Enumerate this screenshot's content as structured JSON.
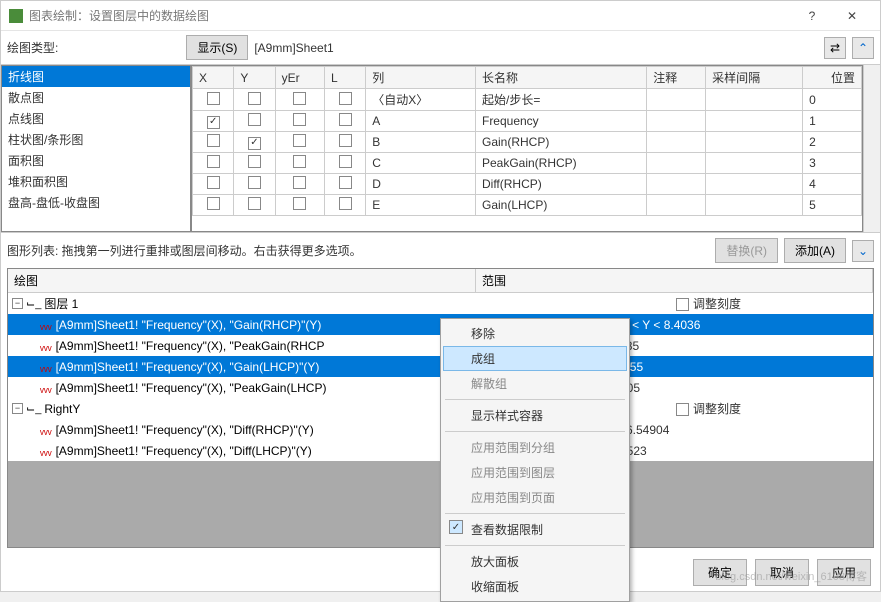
{
  "window": {
    "title": "图表绘制：设置图层中的数据绘图"
  },
  "topbar": {
    "plot_type_label": "绘图类型:",
    "show_button": "显示(S)",
    "sheet_name": "[A9mm]Sheet1"
  },
  "plot_types": [
    "折线图",
    "散点图",
    "点线图",
    "柱状图/条形图",
    "面积图",
    "堆积面积图",
    "盘高-盘低-收盘图"
  ],
  "plot_types_selected": 0,
  "grid": {
    "headers": [
      "X",
      "Y",
      "yEr",
      "L",
      "列",
      "长名称",
      "注释",
      "采样间隔",
      "位置"
    ],
    "rows": [
      {
        "x": false,
        "y": false,
        "yer": false,
        "l": false,
        "col": "〈自动X〉",
        "name": "起始/步长=",
        "pos": "0"
      },
      {
        "x": true,
        "y": false,
        "yer": false,
        "l": false,
        "col": "A",
        "name": "Frequency",
        "pos": "1"
      },
      {
        "x": false,
        "y": true,
        "yer": false,
        "l": false,
        "col": "B",
        "name": "Gain(RHCP)",
        "pos": "2"
      },
      {
        "x": false,
        "y": false,
        "yer": false,
        "l": false,
        "col": "C",
        "name": "PeakGain(RHCP)",
        "pos": "3"
      },
      {
        "x": false,
        "y": false,
        "yer": false,
        "l": false,
        "col": "D",
        "name": "Diff(RHCP)",
        "pos": "4"
      },
      {
        "x": false,
        "y": false,
        "yer": false,
        "l": false,
        "col": "E",
        "name": "Gain(LHCP)",
        "pos": "5"
      }
    ]
  },
  "graphlist": {
    "label": "图形列表: 拖拽第一列进行重排或图层间移动。右击获得更多选项。",
    "replace_btn": "替换(R)",
    "add_btn": "添加(A)"
  },
  "tree": {
    "col1": "绘图",
    "col2": "范围",
    "adjust_scale": "调整刻度",
    "rows": [
      {
        "type": "layer",
        "label": "图层 1",
        "right_checkbox": true
      },
      {
        "type": "plot",
        "sel": true,
        "label": "[A9mm]Sheet1! \"Frequency\"(X), \"Gain(RHCP)\"(Y)",
        "range": "[1*:31*]   4 < X < 7 , -3.42631 < Y < 8.4036"
      },
      {
        "type": "plot",
        "sel": false,
        "label": "[A9mm]Sheet1! \"Frequency\"(X), \"PeakGain(RHCP",
        "range": "X < 7 , 1.26337 < Y < 8.41185"
      },
      {
        "type": "plot",
        "sel": true,
        "label": "[A9mm]Sheet1! \"Frequency\"(X), \"Gain(LHCP)\"(Y)",
        "range": "X < 7 , -11.52068 < Y < 6.6555"
      },
      {
        "type": "plot",
        "sel": false,
        "label": "[A9mm]Sheet1! \"Frequency\"(X), \"PeakGain(LHCP)",
        "range": "X < 7 , 3.01598 < Y < 7.37405"
      },
      {
        "type": "layer",
        "label": "RightY",
        "right_checkbox": true
      },
      {
        "type": "plot",
        "sel": false,
        "label": "[A9mm]Sheet1! \"Frequency\"(X), \"Diff(RHCP)\"(Y)",
        "range": "X < 7 , -1.77636E-15 < Y < 6.54904"
      },
      {
        "type": "plot",
        "sel": false,
        "label": "[A9mm]Sheet1! \"Frequency\"(X), \"Diff(LHCP)\"(Y)",
        "range": "X < 7 , 0.06626 < Y < 15.50523"
      }
    ]
  },
  "context_menu": {
    "remove": "移除",
    "group": "成组",
    "ungroup": "解散组",
    "show_style_container": "显示样式容器",
    "apply_to_group": "应用范围到分组",
    "apply_to_layer": "应用范围到图层",
    "apply_to_page": "应用范围到页面",
    "view_data_limit": "查看数据限制",
    "enlarge_panel": "放大面板",
    "shrink_panel": "收缩面板"
  },
  "footer": {
    "ok": "确定",
    "cancel": "取消",
    "apply": "应用"
  },
  "watermark": "blog.csdn.net/weixin_6108博客"
}
